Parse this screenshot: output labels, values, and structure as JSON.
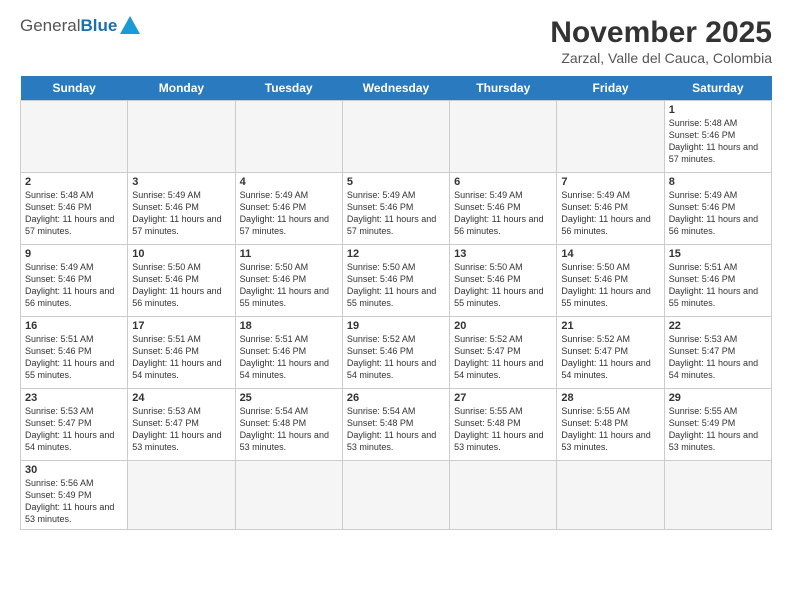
{
  "header": {
    "logo_general": "General",
    "logo_blue": "Blue",
    "month_title": "November 2025",
    "subtitle": "Zarzal, Valle del Cauca, Colombia"
  },
  "days": [
    "Sunday",
    "Monday",
    "Tuesday",
    "Wednesday",
    "Thursday",
    "Friday",
    "Saturday"
  ],
  "weeks": [
    [
      {
        "date": "",
        "empty": true
      },
      {
        "date": "",
        "empty": true
      },
      {
        "date": "",
        "empty": true
      },
      {
        "date": "",
        "empty": true
      },
      {
        "date": "",
        "empty": true
      },
      {
        "date": "",
        "empty": true
      },
      {
        "date": "1",
        "sunrise": "5:48 AM",
        "sunset": "5:46 PM",
        "daylight": "11 hours and 57 minutes."
      }
    ],
    [
      {
        "date": "2",
        "sunrise": "5:48 AM",
        "sunset": "5:46 PM",
        "daylight": "11 hours and 57 minutes."
      },
      {
        "date": "3",
        "sunrise": "5:49 AM",
        "sunset": "5:46 PM",
        "daylight": "11 hours and 57 minutes."
      },
      {
        "date": "4",
        "sunrise": "5:49 AM",
        "sunset": "5:46 PM",
        "daylight": "11 hours and 57 minutes."
      },
      {
        "date": "5",
        "sunrise": "5:49 AM",
        "sunset": "5:46 PM",
        "daylight": "11 hours and 57 minutes."
      },
      {
        "date": "6",
        "sunrise": "5:49 AM",
        "sunset": "5:46 PM",
        "daylight": "11 hours and 56 minutes."
      },
      {
        "date": "7",
        "sunrise": "5:49 AM",
        "sunset": "5:46 PM",
        "daylight": "11 hours and 56 minutes."
      },
      {
        "date": "8",
        "sunrise": "5:49 AM",
        "sunset": "5:46 PM",
        "daylight": "11 hours and 56 minutes."
      }
    ],
    [
      {
        "date": "9",
        "sunrise": "5:49 AM",
        "sunset": "5:46 PM",
        "daylight": "11 hours and 56 minutes."
      },
      {
        "date": "10",
        "sunrise": "5:50 AM",
        "sunset": "5:46 PM",
        "daylight": "11 hours and 56 minutes."
      },
      {
        "date": "11",
        "sunrise": "5:50 AM",
        "sunset": "5:46 PM",
        "daylight": "11 hours and 55 minutes."
      },
      {
        "date": "12",
        "sunrise": "5:50 AM",
        "sunset": "5:46 PM",
        "daylight": "11 hours and 55 minutes."
      },
      {
        "date": "13",
        "sunrise": "5:50 AM",
        "sunset": "5:46 PM",
        "daylight": "11 hours and 55 minutes."
      },
      {
        "date": "14",
        "sunrise": "5:50 AM",
        "sunset": "5:46 PM",
        "daylight": "11 hours and 55 minutes."
      },
      {
        "date": "15",
        "sunrise": "5:51 AM",
        "sunset": "5:46 PM",
        "daylight": "11 hours and 55 minutes."
      }
    ],
    [
      {
        "date": "16",
        "sunrise": "5:51 AM",
        "sunset": "5:46 PM",
        "daylight": "11 hours and 55 minutes."
      },
      {
        "date": "17",
        "sunrise": "5:51 AM",
        "sunset": "5:46 PM",
        "daylight": "11 hours and 54 minutes."
      },
      {
        "date": "18",
        "sunrise": "5:51 AM",
        "sunset": "5:46 PM",
        "daylight": "11 hours and 54 minutes."
      },
      {
        "date": "19",
        "sunrise": "5:52 AM",
        "sunset": "5:46 PM",
        "daylight": "11 hours and 54 minutes."
      },
      {
        "date": "20",
        "sunrise": "5:52 AM",
        "sunset": "5:47 PM",
        "daylight": "11 hours and 54 minutes."
      },
      {
        "date": "21",
        "sunrise": "5:52 AM",
        "sunset": "5:47 PM",
        "daylight": "11 hours and 54 minutes."
      },
      {
        "date": "22",
        "sunrise": "5:53 AM",
        "sunset": "5:47 PM",
        "daylight": "11 hours and 54 minutes."
      }
    ],
    [
      {
        "date": "23",
        "sunrise": "5:53 AM",
        "sunset": "5:47 PM",
        "daylight": "11 hours and 54 minutes."
      },
      {
        "date": "24",
        "sunrise": "5:53 AM",
        "sunset": "5:47 PM",
        "daylight": "11 hours and 53 minutes."
      },
      {
        "date": "25",
        "sunrise": "5:54 AM",
        "sunset": "5:48 PM",
        "daylight": "11 hours and 53 minutes."
      },
      {
        "date": "26",
        "sunrise": "5:54 AM",
        "sunset": "5:48 PM",
        "daylight": "11 hours and 53 minutes."
      },
      {
        "date": "27",
        "sunrise": "5:55 AM",
        "sunset": "5:48 PM",
        "daylight": "11 hours and 53 minutes."
      },
      {
        "date": "28",
        "sunrise": "5:55 AM",
        "sunset": "5:48 PM",
        "daylight": "11 hours and 53 minutes."
      },
      {
        "date": "29",
        "sunrise": "5:55 AM",
        "sunset": "5:49 PM",
        "daylight": "11 hours and 53 minutes."
      }
    ],
    [
      {
        "date": "30",
        "sunrise": "5:56 AM",
        "sunset": "5:49 PM",
        "daylight": "11 hours and 53 minutes."
      },
      {
        "date": "",
        "empty": true
      },
      {
        "date": "",
        "empty": true
      },
      {
        "date": "",
        "empty": true
      },
      {
        "date": "",
        "empty": true
      },
      {
        "date": "",
        "empty": true
      },
      {
        "date": "",
        "empty": true
      }
    ]
  ],
  "labels": {
    "sunrise_prefix": "Sunrise: ",
    "sunset_prefix": "Sunset: ",
    "daylight_prefix": "Daylight: "
  }
}
